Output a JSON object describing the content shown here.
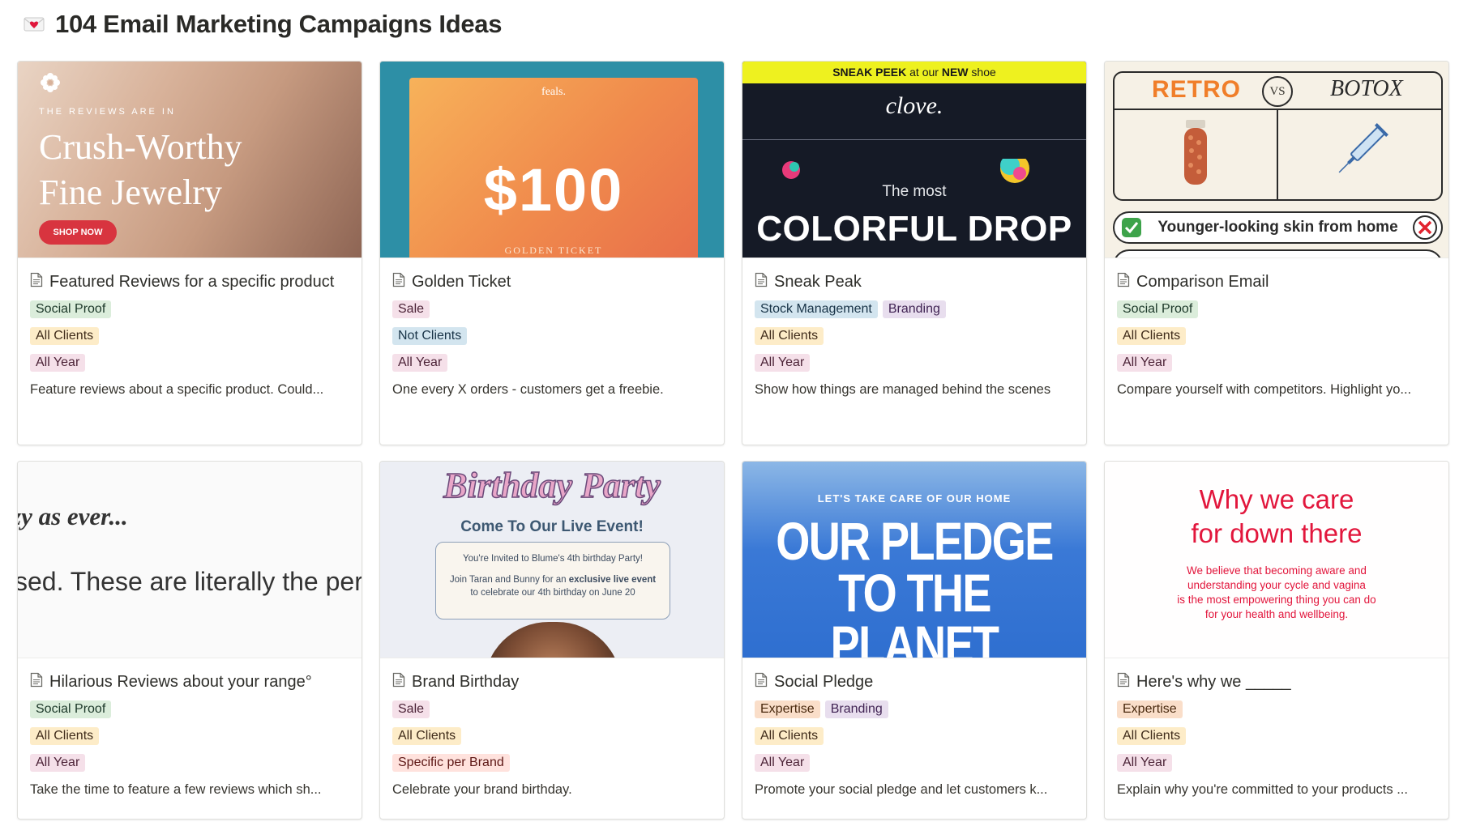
{
  "page": {
    "icon": "envelope-with-heart-icon",
    "title": "104 Email Marketing Campaigns Ideas"
  },
  "colors": {
    "green": "#dbeddb",
    "yellow": "#fdecc8",
    "pink": "#f5e0e9",
    "blue": "#d3e5ef",
    "purple": "#e8deee",
    "orange": "#fadec9",
    "red": "#ffe2dd"
  },
  "cards": [
    {
      "title": "Featured Reviews for a specific product",
      "tags": [
        "Social Proof",
        "All Clients",
        "All Year"
      ],
      "description": "Feature reviews about a specific product. Could...",
      "cover": {
        "kicker": "THE REVIEWS ARE IN",
        "headline_1": "Crush-Worthy",
        "headline_2": "Fine Jewelry",
        "button": "SHOP NOW"
      }
    },
    {
      "title": "Golden Ticket",
      "tags": [
        "Sale",
        "Not Clients",
        "All Year"
      ],
      "description": "One every X orders - customers get a freebie.",
      "cover": {
        "brand": "feals.",
        "amount": "$100",
        "footer": "GOLDEN TICKET"
      }
    },
    {
      "title": "Sneak Peak",
      "tags": [
        "Stock Management",
        "Branding",
        "All Clients",
        "All Year"
      ],
      "description": "Show how things are managed behind the scenes",
      "cover": {
        "banner_1": "SNEAK PEEK",
        "banner_2": " at our ",
        "banner_3": "NEW",
        "banner_4": " shoe",
        "logo": "clove.",
        "lead": "The most",
        "big": "COLORFUL DROP"
      }
    },
    {
      "title": "Comparison Email",
      "tags": [
        "Social Proof",
        "All Clients",
        "All Year"
      ],
      "description": "Compare yourself with competitors. Highlight yo...",
      "cover": {
        "left": "RETRO",
        "vs": "VS",
        "right": "BOTOX",
        "claim": "Younger-looking skin from home"
      }
    },
    {
      "title": "Hilarious Reviews about your range°",
      "tags": [
        "Social Proof",
        "All Clients",
        "All Year"
      ],
      "description": "Take the time to feature a few reviews which sh...",
      "cover": {
        "line_1": "zy as ever...",
        "line_2": "sed.  These are literally the per"
      }
    },
    {
      "title": "Brand Birthday",
      "tags": [
        "Sale",
        "All Clients",
        "Specific per Brand"
      ],
      "description": "Celebrate your brand birthday.",
      "cover": {
        "script": "Birthday Party",
        "come": "Come To Our Live Event!",
        "invite": "You're Invited to Blume's 4th birthday Party!",
        "join_1": "Join Taran and Bunny for an ",
        "join_2": "exclusive live event",
        "join_3": "to celebrate our 4th birthday on June 20"
      }
    },
    {
      "title": "Social Pledge",
      "tags": [
        "Expertise",
        "Branding",
        "All Clients",
        "All Year"
      ],
      "description": "Promote your social pledge and let customers k...",
      "cover": {
        "lets": "LET'S TAKE CARE OF OUR HOME",
        "big_1": "OUR PLEDGE",
        "big_2": "TO THE PLANET"
      }
    },
    {
      "title": "Here's why we _____",
      "tags": [
        "Expertise",
        "All Clients",
        "All Year"
      ],
      "description": "Explain why you're committed to your products ...",
      "cover": {
        "heading_1": "Why we care",
        "heading_2": "for down there",
        "body_1": "We believe that becoming aware and",
        "body_2": "understanding your cycle and vagina",
        "body_3": "is the most empowering thing you can do",
        "body_4": "for your health and wellbeing."
      }
    }
  ]
}
